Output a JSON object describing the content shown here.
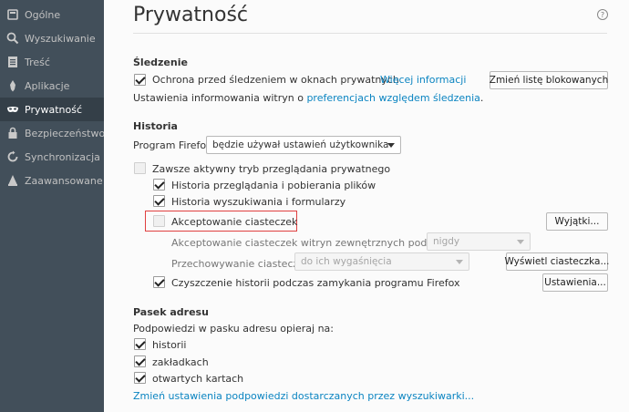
{
  "sidebar": {
    "items": [
      {
        "label": "Ogólne",
        "icon": "general-icon"
      },
      {
        "label": "Wyszukiwanie",
        "icon": "search-icon"
      },
      {
        "label": "Treść",
        "icon": "content-icon"
      },
      {
        "label": "Aplikacje",
        "icon": "applications-icon"
      },
      {
        "label": "Prywatność",
        "icon": "privacy-mask-icon",
        "active": true
      },
      {
        "label": "Bezpieczeństwo",
        "icon": "security-lock-icon"
      },
      {
        "label": "Synchronizacja",
        "icon": "sync-icon"
      },
      {
        "label": "Zaawansowane",
        "icon": "advanced-icon"
      }
    ]
  },
  "page": {
    "title": "Prywatność",
    "help": "?"
  },
  "tracking": {
    "heading": "Śledzenie",
    "protection_label": "Ochrona przed śledzeniem w oknach prywatnych",
    "protection_checked": true,
    "learn_more": "Więcej informacji",
    "change_blocklist": "Zmień listę blokowanych",
    "dnt_prefix": "Ustawienia informowania witryn o",
    "dnt_link": "preferencjach względem śledzenia",
    "dnt_suffix": "."
  },
  "history": {
    "heading": "Historia",
    "program_label": "Program Firefox:",
    "mode_value": "będzie używał ustawień użytkownika",
    "private_mode_label": "Zawsze aktywny tryb przeglądania prywatnego",
    "private_mode_checked": false,
    "browsing_history_label": "Historia przeglądania i pobierania plików",
    "browsing_history_checked": true,
    "search_history_label": "Historia wyszukiwania i formularzy",
    "search_history_checked": true,
    "accept_cookies_label": "Akceptowanie ciasteczek",
    "accept_cookies_checked": false,
    "exceptions_button": "Wyjątki...",
    "third_party_label": "Akceptowanie ciasteczek witryn zewnętrznych podmiotów:",
    "third_party_value": "nigdy",
    "keep_until_label": "Przechowywanie ciasteczek:",
    "keep_until_value": "do ich wygaśnięcia",
    "show_cookies_button": "Wyświetl ciasteczka...",
    "clear_on_close_label": "Czyszczenie historii podczas zamykania programu Firefox",
    "clear_on_close_checked": true,
    "settings_button": "Ustawienia..."
  },
  "location_bar": {
    "heading": "Pasek adresu",
    "suggest_label": "Podpowiedzi w pasku adresu opieraj na:",
    "history_label": "historii",
    "bookmarks_label": "zakładkach",
    "open_tabs_label": "otwartych kartach",
    "change_link": "Zmień ustawienia podpowiedzi dostarczanych przez wyszukiwarki..."
  },
  "colors": {
    "sidebar_bg": "#424f5a",
    "sidebar_active": "#343f48",
    "link": "#0a84c1",
    "highlight_border": "#e04040"
  }
}
